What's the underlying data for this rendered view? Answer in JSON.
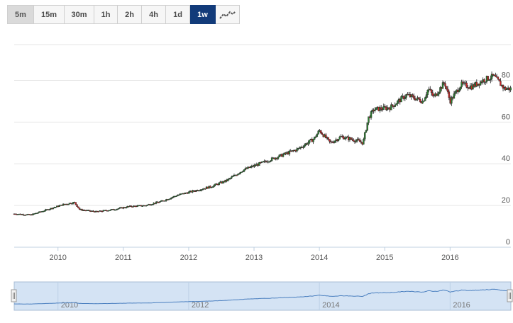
{
  "toolbar": {
    "timeframes": [
      "5m",
      "15m",
      "30m",
      "1h",
      "2h",
      "4h",
      "1d",
      "1w"
    ],
    "active": "1w",
    "chart_type_icon": "line-chart-icon"
  },
  "colors": {
    "up": "#2e7d32",
    "down": "#c62828",
    "wick": "#222222",
    "navigator_line": "#4a7fbf",
    "navigator_fill": "#cfe0f3",
    "active_button": "#123b7a"
  },
  "chart_data": {
    "type": "candlestick",
    "title": "",
    "xlabel": "",
    "ylabel": "",
    "x_ticks": [
      "2010",
      "2011",
      "2012",
      "2013",
      "2014",
      "2015",
      "2016"
    ],
    "y_ticks": [
      "0",
      "20",
      "40",
      "60",
      "80"
    ],
    "ylim": [
      0,
      90
    ],
    "grid": true,
    "series": [
      {
        "t": [
          "2009-05",
          "2009-08",
          "2009-11",
          "2010-02",
          "2010-04",
          "2010-05",
          "2010-08",
          "2010-11",
          "2011-02",
          "2011-05",
          "2011-08",
          "2011-11",
          "2012-02",
          "2012-05",
          "2012-08",
          "2012-11",
          "2013-02",
          "2013-05",
          "2013-07",
          "2013-09",
          "2013-12",
          "2014-01",
          "2014-03",
          "2014-05",
          "2014-08",
          "2014-09",
          "2014-10",
          "2014-11",
          "2015-02",
          "2015-05",
          "2015-08",
          "2015-09",
          "2015-10",
          "2015-12",
          "2016-01",
          "2016-03",
          "2016-05",
          "2016-07",
          "2016-09",
          "2016-11"
        ],
        "v": [
          16,
          15.5,
          18,
          20.5,
          21.5,
          18,
          17,
          18,
          19.5,
          20,
          22,
          25,
          27,
          29,
          32,
          37,
          40,
          43,
          45,
          47,
          52,
          56,
          50,
          53,
          51,
          50,
          62,
          66,
          67,
          73,
          70,
          76,
          72,
          79,
          70,
          78,
          77,
          80,
          82,
          76
        ]
      }
    ]
  },
  "navigator": {
    "labels": [
      "2010",
      "2012",
      "2014",
      "2016"
    ]
  }
}
